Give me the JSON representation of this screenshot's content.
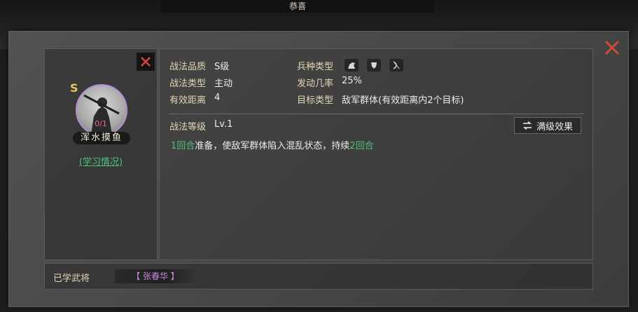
{
  "background": {
    "banner_text": "恭喜",
    "tabs": [
      "",
      "",
      "",
      "",
      "",
      ""
    ]
  },
  "skill": {
    "grade": "S",
    "name": "浑水摸鱼",
    "avatar_number": "0/1",
    "learn_link": "(学习情况)"
  },
  "info": {
    "quality_label": "战法品质",
    "quality_value": "S级",
    "type_label": "战法类型",
    "type_value": "主动",
    "range_label": "有效距离",
    "range_value": "4",
    "troop_label": "兵种类型",
    "troop_icons": [
      "cavalry-icon",
      "shield-icon",
      "bow-icon"
    ],
    "rate_label": "发动几率",
    "rate_value": "25%",
    "target_label": "目标类型",
    "target_value": "敌军群体(有效距离内2个目标)",
    "level_label": "战法等级",
    "level_value": "Lv.1",
    "max_button": "满级效果"
  },
  "description": {
    "part1_green": "1回合",
    "part2": "准备，使敌军群体陷入混乱状态，持续",
    "part3_green": "2回合"
  },
  "learned": {
    "label": "已学武将",
    "general": "【 张春华 】"
  },
  "colors": {
    "close_red": "#d24a3a",
    "accent_green": "#4fc07a",
    "label_gold": "#e2d6b4",
    "purple": "#c58ae0"
  }
}
